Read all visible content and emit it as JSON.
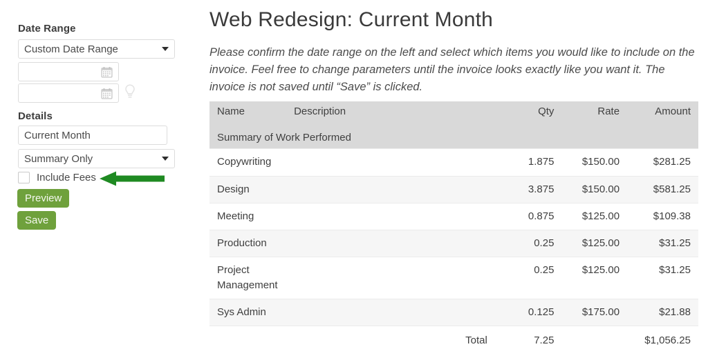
{
  "sidebar": {
    "date_range": {
      "label": "Date Range",
      "select_value": "Custom Date Range",
      "start_value": "",
      "start_placeholder": "",
      "end_value": "",
      "end_placeholder": "",
      "calendar_icon": "calendar-icon",
      "hint_icon": "lightbulb-icon"
    },
    "details": {
      "label": "Details",
      "name_value": "Current Month",
      "name_placeholder": "",
      "type_value": "Summary Only",
      "include_fees_label": "Include Fees",
      "include_fees_checked": false
    },
    "buttons": {
      "preview": "Preview",
      "save": "Save"
    },
    "annotation": {
      "arrow_color": "#1f8a22",
      "points_to": "Include Fees"
    }
  },
  "main": {
    "title": "Web Redesign: Current Month",
    "intro": "Please confirm the date range on the left and select which items you would like to include on the invoice. Feel free to change parameters until the invoice looks exactly like you want it. The invoice is not saved until “Save” is clicked.",
    "table": {
      "caption": "Summary of Work Performed",
      "columns": [
        "Name",
        "Description",
        "Qty",
        "Rate",
        "Amount"
      ],
      "rows": [
        {
          "name": "Copywriting",
          "description": "",
          "qty": "1.875",
          "rate": "$150.00",
          "amount": "$281.25"
        },
        {
          "name": "Design",
          "description": "",
          "qty": "3.875",
          "rate": "$150.00",
          "amount": "$581.25"
        },
        {
          "name": "Meeting",
          "description": "",
          "qty": "0.875",
          "rate": "$125.00",
          "amount": "$109.38"
        },
        {
          "name": "Production",
          "description": "",
          "qty": "0.25",
          "rate": "$125.00",
          "amount": "$31.25"
        },
        {
          "name": "Project Management",
          "description": "",
          "qty": "0.25",
          "rate": "$125.00",
          "amount": "$31.25"
        },
        {
          "name": "Sys Admin",
          "description": "",
          "qty": "0.125",
          "rate": "$175.00",
          "amount": "$21.88"
        }
      ],
      "total": {
        "label": "Total",
        "qty": "7.25",
        "rate": "",
        "amount": "$1,056.25"
      }
    }
  },
  "colors": {
    "button_green": "#6fa13c",
    "arrow_green": "#1f8a22",
    "table_header_gray": "#d9d9d9",
    "row_alt_gray": "#f6f6f6"
  }
}
